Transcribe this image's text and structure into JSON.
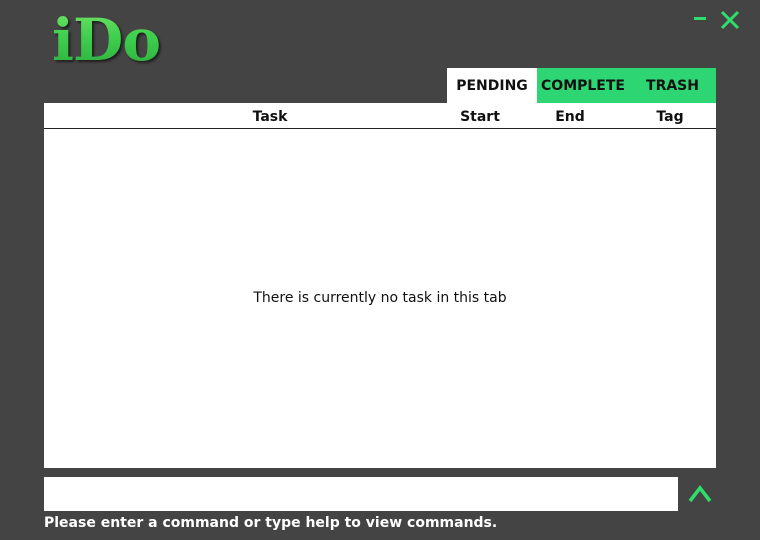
{
  "app": {
    "logo_text": "iDo"
  },
  "window_controls": {
    "minimize_icon": "minimize-icon",
    "close_icon": "close-icon",
    "accent_color": "#2ee06a"
  },
  "tabs": [
    {
      "label": "PENDING",
      "active": true
    },
    {
      "label": "COMPLETE",
      "active": false
    },
    {
      "label": "TRASH",
      "active": false
    }
  ],
  "table": {
    "columns": [
      "Task",
      "Start",
      "End",
      "Tag"
    ],
    "rows": [],
    "empty_message": "There is currently no task in this tab"
  },
  "command": {
    "value": "",
    "placeholder": "",
    "submit_icon": "caret-up-icon",
    "hint": "Please enter a command or type help to view commands."
  },
  "colors": {
    "background": "#444444",
    "tab_green": "#2ed573",
    "logo_green": "#3fd45a"
  }
}
